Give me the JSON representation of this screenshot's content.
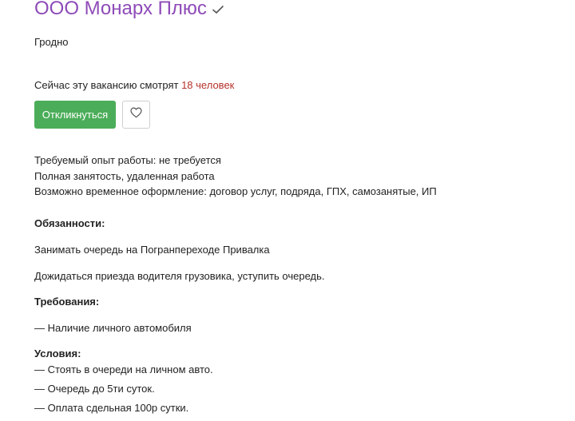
{
  "company": {
    "name": "ООО Монарх Плюс",
    "verified_icon": "checkmark-icon"
  },
  "location": {
    "city": "Гродно"
  },
  "viewers": {
    "prefix": "Сейчас эту вакансию смотрят ",
    "count_text": "18 человек"
  },
  "actions": {
    "respond_label": "Откликнуться",
    "favorite_icon": "heart-icon"
  },
  "details": {
    "experience": "Требуемый опыт работы: не требуется",
    "employment": "Полная занятость, удаленная работа",
    "contract": "Возможно временное оформление: договор услуг, подряда, ГПХ, самозанятые, ИП"
  },
  "duties": {
    "heading": "Обязанности:",
    "items": [
      "Занимать очередь на Погранпереходе Привалка",
      "Дожидаться приезда водителя грузовика, уступить очередь."
    ]
  },
  "requirements": {
    "heading": "Требования:",
    "items": [
      "— Наличие личного автомобиля"
    ]
  },
  "conditions": {
    "heading": "Условия:",
    "items": [
      "— Стоять в очереди на личном авто.",
      "— Очередь до 5ти суток.",
      "— Оплата сдельная 100р сутки."
    ]
  },
  "colors": {
    "company_name": "#8e4bb8",
    "viewers_count": "#b5322a",
    "respond_button": "#4bad59"
  }
}
